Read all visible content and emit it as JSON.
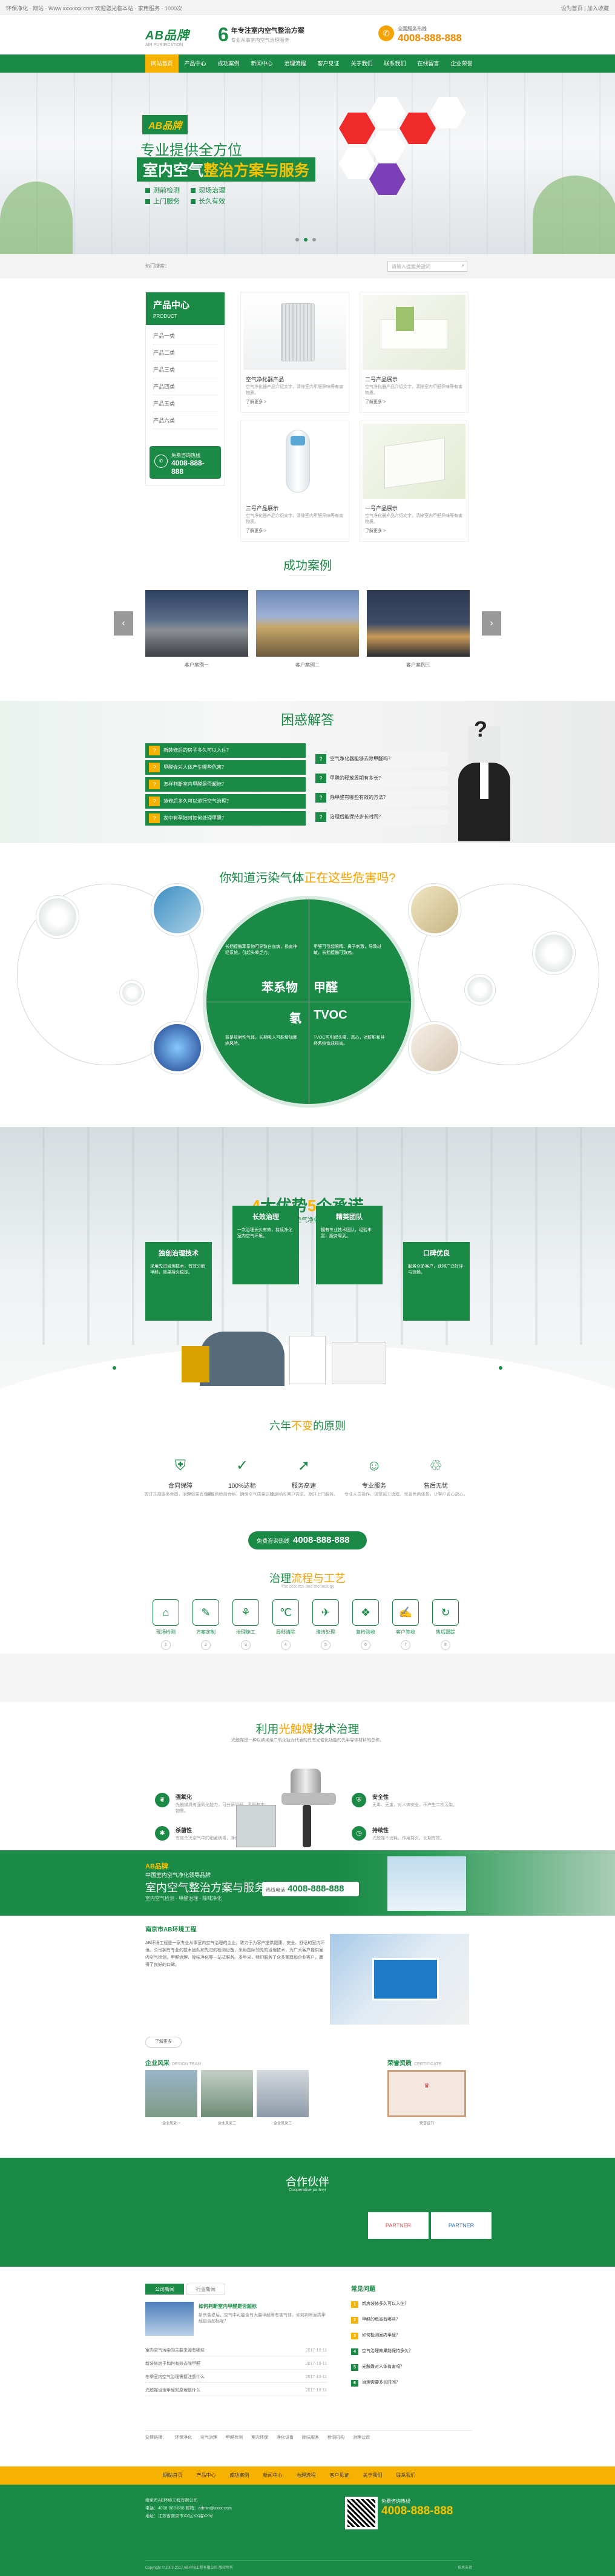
{
  "topbar": {
    "left": "环保净化 · 网站 · Www.xxxxxxx.com 欢迎您光临本站 · 家用服务 · 1000次",
    "right": "设为首页 | 加入收藏"
  },
  "header": {
    "logo": "AB品牌",
    "logo_sub": "AIR PURIFICATION",
    "slogan_num": "6",
    "slogan_main": "年专注室内空气整治方案",
    "slogan_sub": "专业从事室内空气治理服务",
    "phone_label": "全国服务热线",
    "phone": "4008-888-888"
  },
  "nav": [
    "网站首页",
    "产品中心",
    "成功案例",
    "新闻中心",
    "治理流程",
    "客户见证",
    "关于我们",
    "联系我们",
    "在线留言",
    "企业荣誉"
  ],
  "banner": {
    "badge": "AB品牌",
    "line1": "专业提供全方位",
    "line2a": "室内空气",
    "line2b": "整治方案与服务",
    "bullets": [
      "测前检测",
      "现场治理",
      "上门服务",
      "长久有效"
    ]
  },
  "crumb": {
    "text": "热门搜索：",
    "search_placeholder": "请输入搜索关键词"
  },
  "products": {
    "title": "产品中心",
    "title_en": "PRODUCT",
    "categories": [
      "产品一类",
      "产品二类",
      "产品三类",
      "产品四类",
      "产品五类",
      "产品六类"
    ],
    "call_label": "免费咨询热线",
    "call_phone": "4008-888-888",
    "items": [
      {
        "title": "空气净化器产品",
        "desc": "空气净化器产品介绍文字，清除室内甲醛异味等有害物质。",
        "more": "了解更多 >"
      },
      {
        "title": "二号产品展示",
        "desc": "空气净化器产品介绍文字，清除室内甲醛异味等有害物质。",
        "more": "了解更多 >"
      },
      {
        "title": "三号产品展示",
        "desc": "空气净化器产品介绍文字，清除室内甲醛异味等有害物质。",
        "more": "了解更多 >"
      },
      {
        "title": "一号产品展示",
        "desc": "空气净化器产品介绍文字，清除室内甲醛异味等有害物质。",
        "more": "了解更多 >"
      }
    ]
  },
  "cases": {
    "title": "成功案例",
    "items": [
      "客户案例一",
      "客户案例二",
      "客户案例三"
    ]
  },
  "qa": {
    "title": "困惑解答",
    "left": [
      "新装修后的房子多久可以入住？",
      "甲醛会对人体产生哪些危害？",
      "怎样判断室内甲醛是否超标？",
      "装修后多久可以进行空气治理？",
      "家中有孕妇时如何处理甲醛？"
    ],
    "right": [
      "空气净化器能够去除甲醛吗？",
      "甲醛的释放周期有多长？",
      "除甲醛有哪些有效的方法？",
      "治理后能保持多长时间？"
    ]
  },
  "pollution": {
    "title_a": "你知道污染气体",
    "title_b": "正在这些危害吗?",
    "keys": [
      "苯系物",
      "甲醛",
      "氡",
      "TVOC"
    ],
    "desc": [
      "长期接触苯系物可导致白血病，损害神经系统，引起头晕乏力。",
      "甲醛可引起眼睛、鼻子刺激，导致过敏，长期接触可致癌。",
      "氡是放射性气体，长期吸入可能增加肺癌风险。",
      "TVOC可引起头痛、恶心，对肝脏和神经系统造成损害。"
    ]
  },
  "advantage": {
    "num1": "4",
    "mid": "大优势",
    "num2": "5",
    "end": "个承诺",
    "sub": "中国室内空气净化首选品牌",
    "boxes": [
      {
        "title": "独创治理技术",
        "desc": "采用先进治理技术，有效分解甲醛，效果持久稳定。"
      },
      {
        "title": "长效治理",
        "desc": "一次治理长久有效，持续净化室内空气环境。"
      },
      {
        "title": "精英团队",
        "desc": "拥有专业技术团队，经验丰富，服务周到。"
      },
      {
        "title": "口碑优良",
        "desc": "服务众多客户，获得广泛好评与信赖。"
      }
    ]
  },
  "principles": {
    "title_a": "六年",
    "title_b": "不变",
    "title_c": "的原则",
    "items": [
      {
        "title": "合同保障",
        "desc": "签订正规服务合同，治理效果有保障。"
      },
      {
        "title": "100%达标",
        "desc": "治理后检测合格，确保空气质量达标。"
      },
      {
        "title": "服务高速",
        "desc": "快速响应客户需求，及时上门服务。"
      },
      {
        "title": "专业服务",
        "desc": "专业人员操作，规范施工流程。"
      },
      {
        "title": "售后无忧",
        "desc": "完善售后体系，让客户省心放心。"
      }
    ],
    "btn_label": "免费咨询热线",
    "btn_phone": "4008-888-888"
  },
  "process": {
    "title_a": "治理",
    "title_b": "流程与工艺",
    "sub": "The process and technology",
    "steps": [
      "现场检测",
      "方案定制",
      "治理施工",
      "局部清除",
      "清洁处理",
      "复检验收",
      "客户签收",
      "售后跟踪"
    ],
    "nums": [
      "1",
      "2",
      "3",
      "4",
      "5",
      "6",
      "7",
      "8"
    ]
  },
  "photo": {
    "title_a": "利用",
    "title_b": "光触媒",
    "title_c": "技术治理",
    "sub": "光触媒是一种以纳米级二氧化钛为代表的具有光催化功能的光半导体材料的总称。",
    "feats": [
      {
        "title": "强氧化",
        "desc": "光触媒具有强氧化能力，可分解甲醛、苯等有害物质。"
      },
      {
        "title": "安全性",
        "desc": "无毒、无害，对人体安全，不产生二次污染。"
      },
      {
        "title": "杀菌性",
        "desc": "有效杀灭空气中的细菌病毒，净化室内环境。"
      },
      {
        "title": "持续性",
        "desc": "光触媒不消耗，作用持久，长期有效。"
      }
    ]
  },
  "strip": {
    "top_a": "AB品牌",
    "top_b": "中国室内空气净化领导品牌",
    "main": "室内空气整治方案与服务",
    "sub": "室内空气检测 · 甲醛治理 · 除味净化",
    "phone_label": "热线电话",
    "phone": "4008-888-888"
  },
  "about": {
    "title": "南京市AB环境工程",
    "text": "AB环境工程是一家专业从事室内空气治理的企业，致力于为客户提供健康、安全、舒适的室内环境。公司拥有专业的技术团队和先进的检测设备，采用国际领先的治理技术，为广大客户提供室内空气检测、甲醛治理、除味净化等一站式服务。多年来，我们服务了众多家庭和企业客户，赢得了良好的口碑。",
    "more": "了解更多",
    "team_title": "企业风采",
    "team_en": "DESIGN TEAM",
    "team_caps": [
      "企业风采一",
      "企业风采二",
      "企业风采三"
    ],
    "honor_title": "荣誉资质",
    "honor_en": "CERTIFICATE",
    "honor_cap": "荣誉证书"
  },
  "partner": {
    "title": "合作伙伴",
    "sub": "Cooperative partner",
    "logos": [
      "PARTNER",
      "PARTNER"
    ]
  },
  "news": {
    "tabs": [
      "公司新闻",
      "行业新闻"
    ],
    "headline": "如何判断室内甲醛是否超标",
    "headline_desc": "新房装修后，空气中可能含有大量甲醛等有害气体，如何判断室内甲醛是否超标呢？",
    "rows": [
      {
        "t": "室内空气污染的主要来源有哪些",
        "d": "2017-10-11"
      },
      {
        "t": "新装修房子如何有效去除甲醛",
        "d": "2017-10-11"
      },
      {
        "t": "冬季室内空气治理需要注意什么",
        "d": "2017-10-11"
      },
      {
        "t": "光触媒治理甲醛的原理是什么",
        "d": "2017-10-11"
      }
    ],
    "faq_title": "常见问题",
    "faq": [
      "新房装修多久可以入住？",
      "甲醛的危害有哪些？",
      "如何检测室内甲醛？",
      "空气治理效果能保持多久？",
      "光触媒对人体有害吗？",
      "治理需要多长时间？"
    ],
    "links_label": "友情链接：",
    "links": [
      "环保净化",
      "空气治理",
      "甲醛检测",
      "室内环保",
      "净化设备",
      "除味服务",
      "检测机构",
      "治理公司"
    ]
  },
  "fnav": [
    "网站首页",
    "产品中心",
    "成功案例",
    "新闻中心",
    "治理流程",
    "客户见证",
    "关于我们",
    "联系我们"
  ],
  "footer": {
    "lines": [
      "南京市AB环境工程有限公司",
      "电话：4008-888-888 邮箱：admin@xxxx.com",
      "地址：江苏省南京市XX区XX路XX号"
    ],
    "call_label": "免费咨询热线",
    "phone": "4008-888-888",
    "copy": "Copyright © 2002-2017 AB环境工程有限公司 版权所有",
    "icp": "技术支持"
  },
  "colors": {
    "primary": "#1a8a46",
    "accent": "#f6b200"
  }
}
